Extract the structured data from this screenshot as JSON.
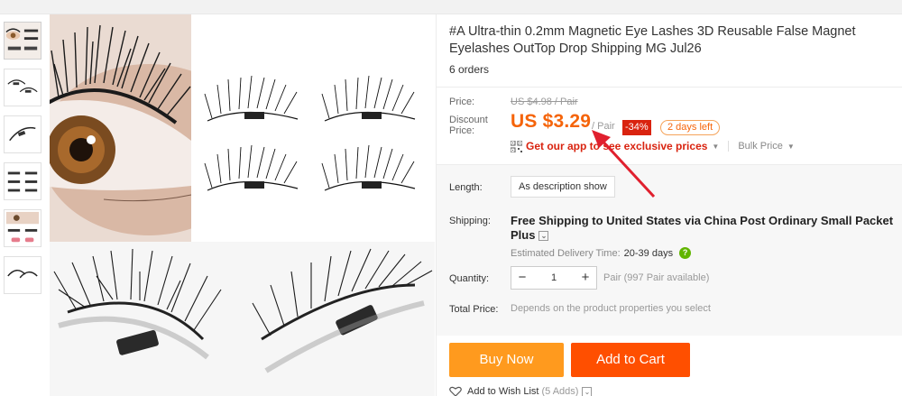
{
  "product": {
    "title": "#A Ultra-thin 0.2mm Magnetic Eye Lashes 3D Reusable False Magnet Eyelashes OutTop Drop Shipping MG Jul26",
    "orders": "6 orders"
  },
  "price": {
    "price_label": "Price:",
    "old_price": "US $4.98 / Pair",
    "discount_label": "Discount Price:",
    "current_price": "US $3.29",
    "per_unit": "/ Pair",
    "discount_badge": "-34%",
    "days_left": "2 days left",
    "app_prompt": "Get our app to see exclusive prices",
    "bulk_price": "Bulk Price"
  },
  "options": {
    "length_label": "Length:",
    "length_value": "As description show",
    "shipping_label": "Shipping:",
    "shipping_bold": "Free Shipping",
    "shipping_to": "to United States via China Post Ordinary Small Packet",
    "shipping_plus": "Plus",
    "eta_label": "Estimated Delivery Time:",
    "eta_value": "20-39 days",
    "quantity_label": "Quantity:",
    "quantity_value": "1",
    "quantity_minus": "−",
    "quantity_plus": "+",
    "quantity_note": "Pair (997 Pair available)",
    "total_label": "Total Price:",
    "total_value": "Depends on the product properties you select"
  },
  "actions": {
    "buy_now": "Buy Now",
    "add_to_cart": "Add to Cart",
    "wishlist": "Add to Wish List",
    "wishlist_count": "(5 Adds)"
  },
  "icons": {
    "qr": "qr-code-icon",
    "help": "help-icon",
    "heart": "heart-icon",
    "help_glyph": "?"
  },
  "colors": {
    "price_orange": "#f5640a",
    "discount_red": "#d9230f",
    "buy_now": "#ff9a1e",
    "add_to_cart": "#ff4f00",
    "annotation_arrow": "#e0202e"
  }
}
